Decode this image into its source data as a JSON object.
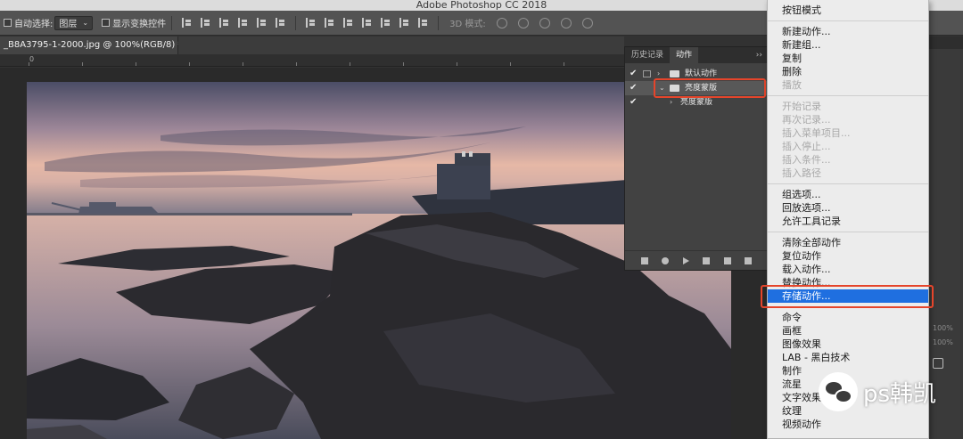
{
  "app": {
    "title": "Adobe Photoshop CC 2018"
  },
  "options_bar": {
    "auto_select_label": "自动选择:",
    "auto_select_value": "图层",
    "show_transform_label": "显示变换控件",
    "mode_3d_label": "3D 模式:"
  },
  "document": {
    "tab_label": "_B8A3795-1-2000.jpg @ 100%(RGB/8) *"
  },
  "ruler": {
    "ticks": [
      "0",
      "",
      "",
      "",
      "",
      "",
      "",
      "",
      "",
      "",
      "",
      "",
      "",
      ""
    ]
  },
  "actions_panel": {
    "tabs": [
      "历史记录",
      "动作"
    ],
    "menu_glyph": "≡",
    "collapse_glyph": "››",
    "rows": [
      {
        "label": "默认动作",
        "checked": "✔"
      },
      {
        "label": "亮度蒙版",
        "checked": "✔"
      },
      {
        "label": "亮度蒙版",
        "checked": "✔"
      }
    ],
    "colors": {
      "highlight_box": "#e5452b"
    }
  },
  "dropdown_menu": {
    "items": [
      {
        "label": "按钮模式",
        "enabled": true
      },
      {
        "label": "新建动作...",
        "enabled": true
      },
      {
        "label": "新建组...",
        "enabled": true
      },
      {
        "label": "复制",
        "enabled": true
      },
      {
        "label": "删除",
        "enabled": true
      },
      {
        "label": "播放",
        "enabled": false
      },
      {
        "label": "开始记录",
        "enabled": false
      },
      {
        "label": "再次记录...",
        "enabled": false
      },
      {
        "label": "插入菜单项目...",
        "enabled": false
      },
      {
        "label": "插入停止...",
        "enabled": false
      },
      {
        "label": "插入条件...",
        "enabled": false
      },
      {
        "label": "插入路径",
        "enabled": false
      },
      {
        "label": "组选项...",
        "enabled": true
      },
      {
        "label": "回放选项...",
        "enabled": true
      },
      {
        "label": "允许工具记录",
        "enabled": true
      },
      {
        "label": "清除全部动作",
        "enabled": true
      },
      {
        "label": "复位动作",
        "enabled": true
      },
      {
        "label": "载入动作...",
        "enabled": true
      },
      {
        "label": "替换动作...",
        "enabled": true
      },
      {
        "label": "存储动作...",
        "enabled": true,
        "highlighted": true
      },
      {
        "label": "命令",
        "enabled": true
      },
      {
        "label": "画框",
        "enabled": true
      },
      {
        "label": "图像效果",
        "enabled": true
      },
      {
        "label": "LAB - 黑白技术",
        "enabled": true
      },
      {
        "label": "制作",
        "enabled": true
      },
      {
        "label": "流星",
        "enabled": true
      },
      {
        "label": "文字效果",
        "enabled": true
      },
      {
        "label": "纹理",
        "enabled": true
      },
      {
        "label": "视频动作",
        "enabled": true
      }
    ],
    "colors": {
      "highlight": "#1f6fe0",
      "highlight_box": "#e5452b"
    }
  },
  "right_panel": {
    "labels": [
      "100%",
      "100%"
    ]
  },
  "watermark": {
    "text": "ps韩凯"
  }
}
